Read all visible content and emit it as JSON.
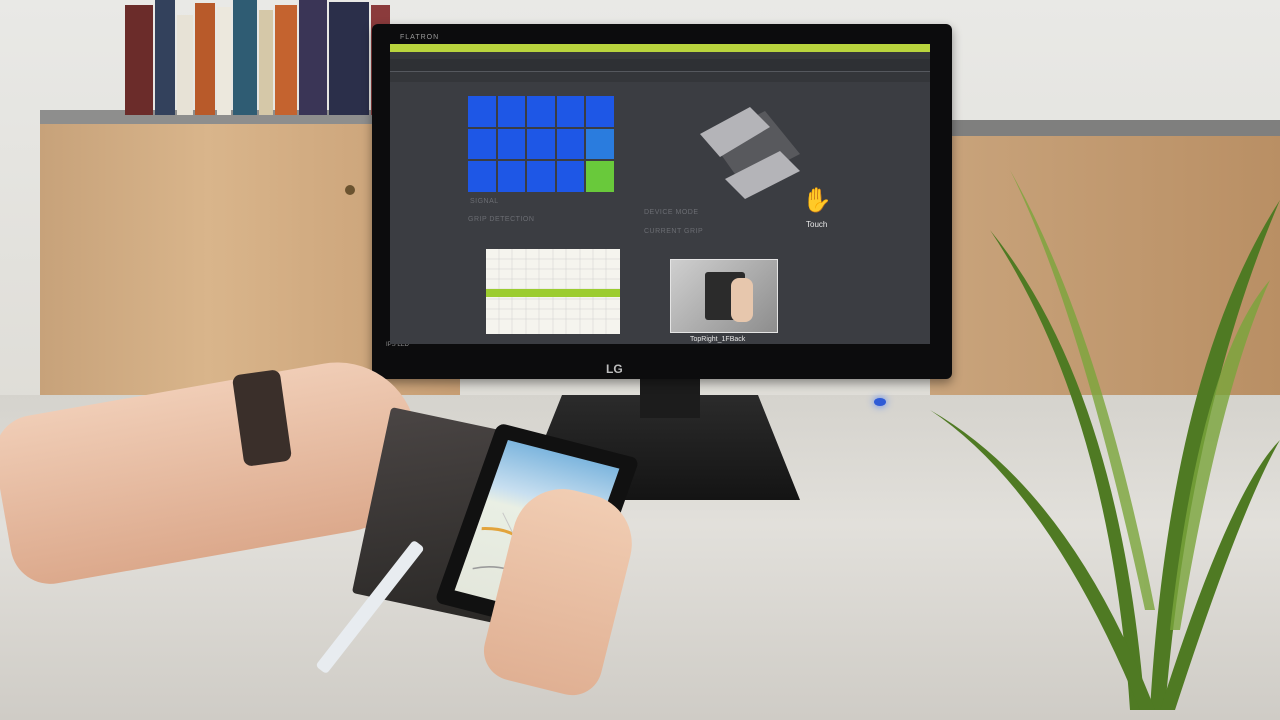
{
  "scene": "photo",
  "monitor": {
    "brand": "FLATRON",
    "logo": "LG",
    "panel_label": "IPS LED"
  },
  "app": {
    "sections": {
      "signal": "SIGNAL",
      "grip_detection": "GRIP DETECTION",
      "device_mode": "DEVICE MODE",
      "current_grip": "CURRENT GRIP"
    },
    "device_mode_value": "Touch",
    "current_grip_caption": "TopRight_1FBack",
    "grid": {
      "rows": 3,
      "cols": 5,
      "colors": {
        "active": "#1e57e6",
        "highlight": "#69c93b",
        "light": "#2a7cde"
      },
      "highlight_cell_index": 14
    },
    "accent_color": "#b9d43d"
  }
}
